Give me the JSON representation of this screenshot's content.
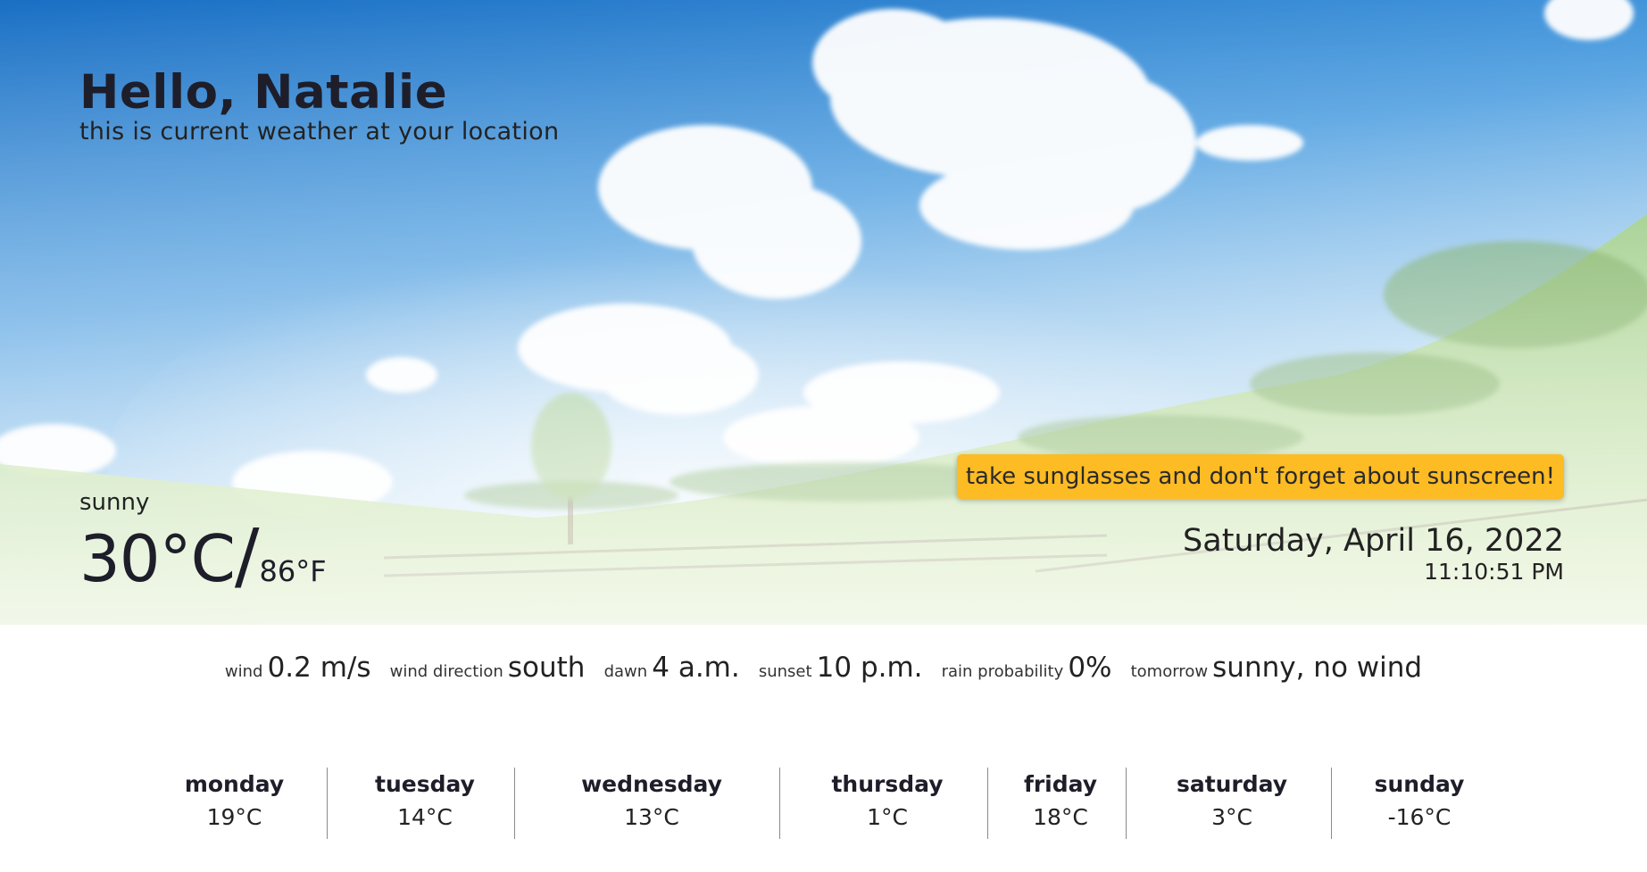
{
  "greeting": {
    "title": "Hello, Natalie",
    "subtitle": "this is current weather at your location"
  },
  "current": {
    "condition": "sunny",
    "temp_c": "30°C",
    "slash": "/",
    "temp_f": "86°F"
  },
  "tip": "take sunglasses and don't forget about sunscreen!",
  "datetime": {
    "date": "Saturday, April 16, 2022",
    "time": "11:10:51 PM"
  },
  "details": [
    {
      "label": "wind",
      "value": "0.2 m/s"
    },
    {
      "label": "wind direction",
      "value": "south"
    },
    {
      "label": "dawn",
      "value": "4 a.m."
    },
    {
      "label": "sunset",
      "value": "10 p.m."
    },
    {
      "label": "rain probability",
      "value": "0%"
    },
    {
      "label": "tomorrow",
      "value": "sunny, no wind"
    }
  ],
  "forecast": [
    {
      "day": "monday",
      "temp": "19°C"
    },
    {
      "day": "tuesday",
      "temp": "14°C"
    },
    {
      "day": "wednesday",
      "temp": "13°C"
    },
    {
      "day": "thursday",
      "temp": "1°C"
    },
    {
      "day": "friday",
      "temp": "18°C"
    },
    {
      "day": "saturday",
      "temp": "3°C"
    },
    {
      "day": "sunday",
      "temp": "-16°C"
    }
  ],
  "colors": {
    "sky_top": "#1f78c8",
    "sky_mid": "#6fb2e8",
    "grass": "#a9d46a",
    "tip_bg": "#fdbb24",
    "text": "#1e1e2a"
  }
}
